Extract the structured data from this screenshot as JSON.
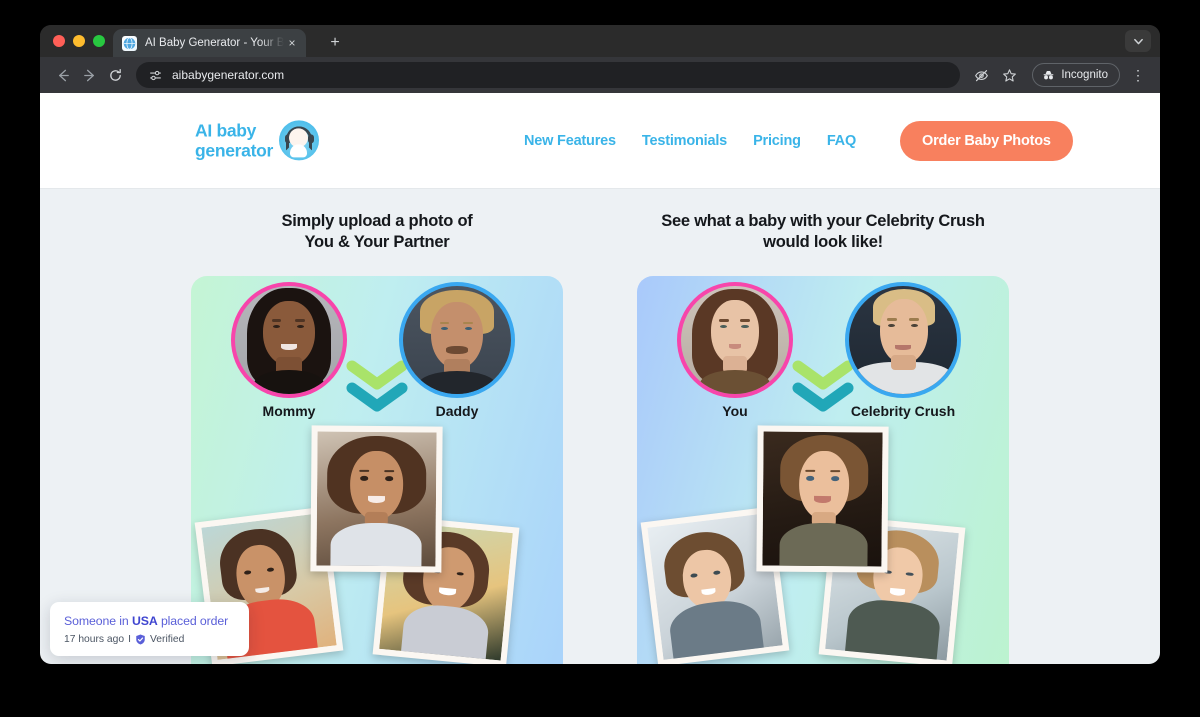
{
  "browser": {
    "tab": {
      "title": "AI Baby Generator - Your Bab",
      "favicon_name": "globe-favicon",
      "close_label": "×"
    },
    "new_tab_label": "+",
    "toolbar": {
      "back_label": "←",
      "forward_label": "→",
      "reload_label": "↻",
      "url": "aibabygenerator.com",
      "incognito_label": "Incognito",
      "menu_label": "⋮"
    }
  },
  "site": {
    "logo": {
      "line1": "AI baby",
      "line2": "generator"
    },
    "nav": [
      {
        "label": "New Features"
      },
      {
        "label": "Testimonials"
      },
      {
        "label": "Pricing"
      },
      {
        "label": "FAQ"
      }
    ],
    "cta": {
      "label": "Order Baby Photos"
    },
    "accent_blue": "#3ab4e8",
    "accent_coral": "#f8805e"
  },
  "hero": {
    "left": {
      "heading_line1": "Simply upload a photo of",
      "heading_line2": "You & Your Partner",
      "parent_a": {
        "label": "Mommy",
        "ring_color": "#f745ab"
      },
      "parent_b": {
        "label": "Daddy",
        "ring_color": "#3aa8f0"
      },
      "arrow_colors": [
        "#a9e36a",
        "#21a7b8"
      ],
      "babies": [
        {
          "name": "baby-photo-center"
        },
        {
          "name": "baby-photo-left"
        },
        {
          "name": "baby-photo-right"
        }
      ]
    },
    "right": {
      "heading_line1": "See what a baby with your Celebrity Crush",
      "heading_line2": "would look like!",
      "parent_a": {
        "label": "You",
        "ring_color": "#f745ab"
      },
      "parent_b": {
        "label": "Celebrity Crush",
        "ring_color": "#3aa8f0"
      },
      "arrow_colors": [
        "#a9e36a",
        "#21a7b8"
      ],
      "babies": [
        {
          "name": "baby-photo-center"
        },
        {
          "name": "baby-photo-left"
        },
        {
          "name": "baby-photo-right"
        }
      ]
    }
  },
  "toast": {
    "prefix": "Someone in ",
    "country": "USA",
    "suffix": " placed order",
    "time": "17 hours ago",
    "separator": "I",
    "verified_label": "Verified",
    "verified_color": "#5a5fd8"
  }
}
